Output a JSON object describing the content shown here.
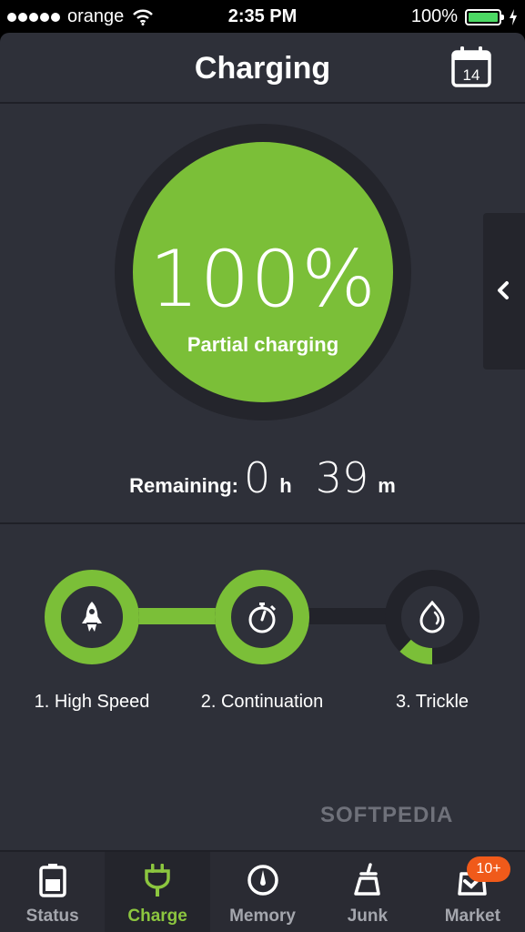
{
  "statusbar": {
    "carrier": "orange",
    "time": "2:35 PM",
    "battery_pct": "100%",
    "signal_bars": 5
  },
  "header": {
    "title": "Charging",
    "calendar_day": "14"
  },
  "gauge": {
    "percent_text": "100%",
    "status": "Partial charging",
    "charge_fraction": 1.0,
    "fill_color": "#7bbf38"
  },
  "remaining": {
    "label": "Remaining:",
    "hours": "0",
    "hours_unit": "h",
    "minutes": "39",
    "minutes_unit": "m"
  },
  "steps": [
    {
      "label": "1. High Speed",
      "icon": "rocket-icon",
      "progress": 1.0
    },
    {
      "label": "2. Continuation",
      "icon": "stopwatch-icon",
      "progress": 1.0
    },
    {
      "label": "3. Trickle",
      "icon": "drop-icon",
      "progress": 0.12
    }
  ],
  "watermark": "SOFTPEDIA",
  "tabbar": {
    "items": [
      {
        "label": "Status",
        "icon": "battery-icon",
        "active": false
      },
      {
        "label": "Charge",
        "icon": "plug-icon",
        "active": true
      },
      {
        "label": "Memory",
        "icon": "gauge-icon",
        "active": false
      },
      {
        "label": "Junk",
        "icon": "broom-icon",
        "active": false
      },
      {
        "label": "Market",
        "icon": "market-bag-icon",
        "active": false
      }
    ],
    "market_badge": "10+"
  },
  "colors": {
    "accent": "#7bbf38",
    "tab_active": "#8cc63f",
    "badge": "#f05a1a",
    "background": "#2e3039"
  }
}
